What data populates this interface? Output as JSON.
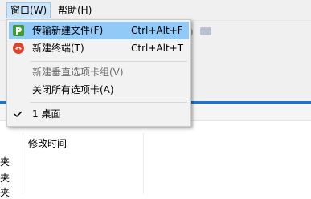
{
  "menubar": {
    "items": [
      {
        "label": "窗口(W)"
      },
      {
        "label": "帮助(H)"
      }
    ]
  },
  "menu": {
    "items": [
      {
        "label": "传输新建文件(F)",
        "shortcut": "Ctrl+Alt+F",
        "icon": "transfer-file-icon"
      },
      {
        "label": "新建终端(T)",
        "shortcut": "Ctrl+Alt+T",
        "icon": "terminal-shell-icon"
      },
      {
        "label": "新建垂直选项卡组(V)",
        "disabled": true
      },
      {
        "label": "关闭所有选项卡(A)"
      },
      {
        "label": "1 桌面",
        "checked": true
      }
    ]
  },
  "list": {
    "column_header": "修改时间",
    "rows": [
      "夹",
      "夹",
      "夹"
    ]
  },
  "colors": {
    "highlight": "#91c9f7",
    "accent_line": "#1874d2",
    "menu_bg": "#f2f2f2"
  }
}
